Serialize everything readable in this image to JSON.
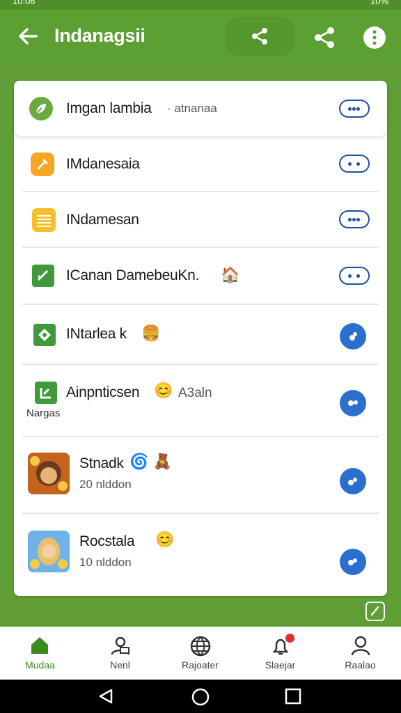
{
  "status_bar": {
    "time": "10:08",
    "battery": "10%"
  },
  "app_bar": {
    "title": "Indanagsii"
  },
  "rows": [
    {
      "label": "Imgan lambia",
      "sub": "· atnanaa"
    },
    {
      "label": "IMdanesaia"
    },
    {
      "label": "INdamesan"
    },
    {
      "label": "ICanan DamebeuKn.",
      "emoji": "🏠"
    },
    {
      "label": "INtarlea k",
      "emoji": "🍔"
    },
    {
      "label": "Ainpnticsen",
      "emoji": "😊",
      "sub": "A3aln",
      "sub2": "Nargas"
    },
    {
      "label": "Stnadk",
      "emoji": "🌀 🧸",
      "sub": "20 nlddon"
    },
    {
      "label": "Rocstala",
      "emoji": "😊",
      "sub": "10 nlddon"
    }
  ],
  "bottom_nav": [
    {
      "label": "Mudaa",
      "icon": "home-icon"
    },
    {
      "label": "Nenl",
      "icon": "people-icon"
    },
    {
      "label": "Rajoater",
      "icon": "globe-icon"
    },
    {
      "label": "Slaejar",
      "icon": "bell-icon"
    },
    {
      "label": "Raalao",
      "icon": "person-icon"
    }
  ],
  "colors": {
    "primary": "#5c9f33",
    "accent_blue": "#2a6fcf",
    "active_nav": "#3d8a1e"
  }
}
